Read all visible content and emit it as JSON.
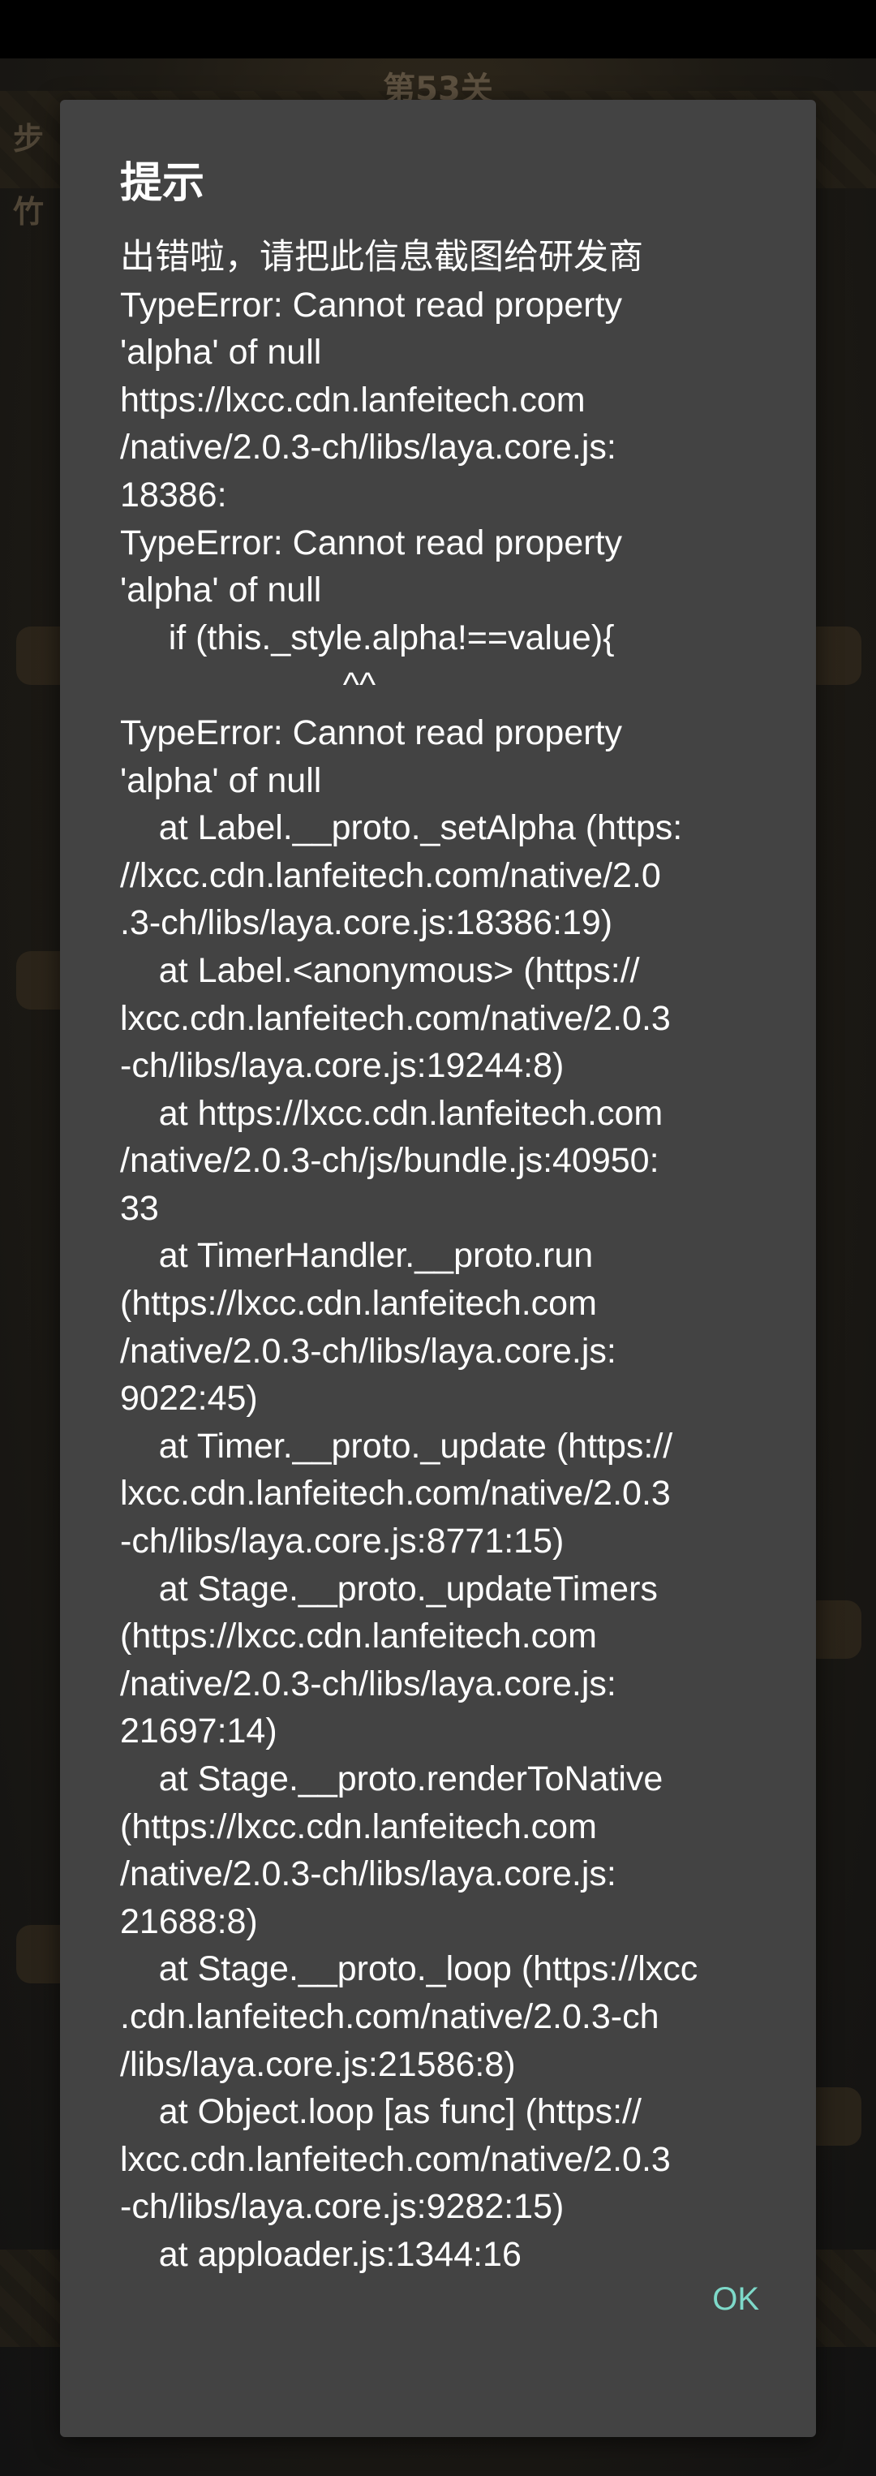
{
  "background": {
    "level_text": "第53关",
    "side_hints": [
      "步",
      "竹"
    ]
  },
  "dialog": {
    "title": "提示",
    "lines": [
      "出错啦，请把此信息截图给研发商",
      "TypeError: Cannot read property",
      "'alpha' of null",
      "https://lxcc.cdn.lanfeitech.com",
      "/native/2.0.3-ch/libs/laya.core.js:",
      "18386:",
      "TypeError: Cannot read property",
      "'alpha' of null",
      "     if (this._style.alpha!==value){",
      "                       ^^",
      "TypeError: Cannot read property",
      "'alpha' of null",
      "    at Label.__proto._setAlpha (https:",
      "//lxcc.cdn.lanfeitech.com/native/2.0",
      ".3-ch/libs/laya.core.js:18386:19)",
      "    at Label.<anonymous> (https://",
      "lxcc.cdn.lanfeitech.com/native/2.0.3",
      "-ch/libs/laya.core.js:19244:8)",
      "    at https://lxcc.cdn.lanfeitech.com",
      "/native/2.0.3-ch/js/bundle.js:40950:",
      "33",
      "    at TimerHandler.__proto.run",
      "(https://lxcc.cdn.lanfeitech.com",
      "/native/2.0.3-ch/libs/laya.core.js:",
      "9022:45)",
      "    at Timer.__proto._update (https://",
      "lxcc.cdn.lanfeitech.com/native/2.0.3",
      "-ch/libs/laya.core.js:8771:15)",
      "    at Stage.__proto._updateTimers",
      "(https://lxcc.cdn.lanfeitech.com",
      "/native/2.0.3-ch/libs/laya.core.js:",
      "21697:14)",
      "    at Stage.__proto.renderToNative",
      "(https://lxcc.cdn.lanfeitech.com",
      "/native/2.0.3-ch/libs/laya.core.js:",
      "21688:8)",
      "    at Stage.__proto._loop (https://lxcc",
      ".cdn.lanfeitech.com/native/2.0.3-ch",
      "/libs/laya.core.js:21586:8)",
      "    at Object.loop [as func] (https://",
      "lxcc.cdn.lanfeitech.com/native/2.0.3",
      "-ch/libs/laya.core.js:9282:15)",
      "    at apploader.js:1344:16"
    ],
    "ok_label": "OK",
    "colors": {
      "dialog_bg": "#434343",
      "text": "#ffffff",
      "accent": "#7ed9c9"
    }
  }
}
